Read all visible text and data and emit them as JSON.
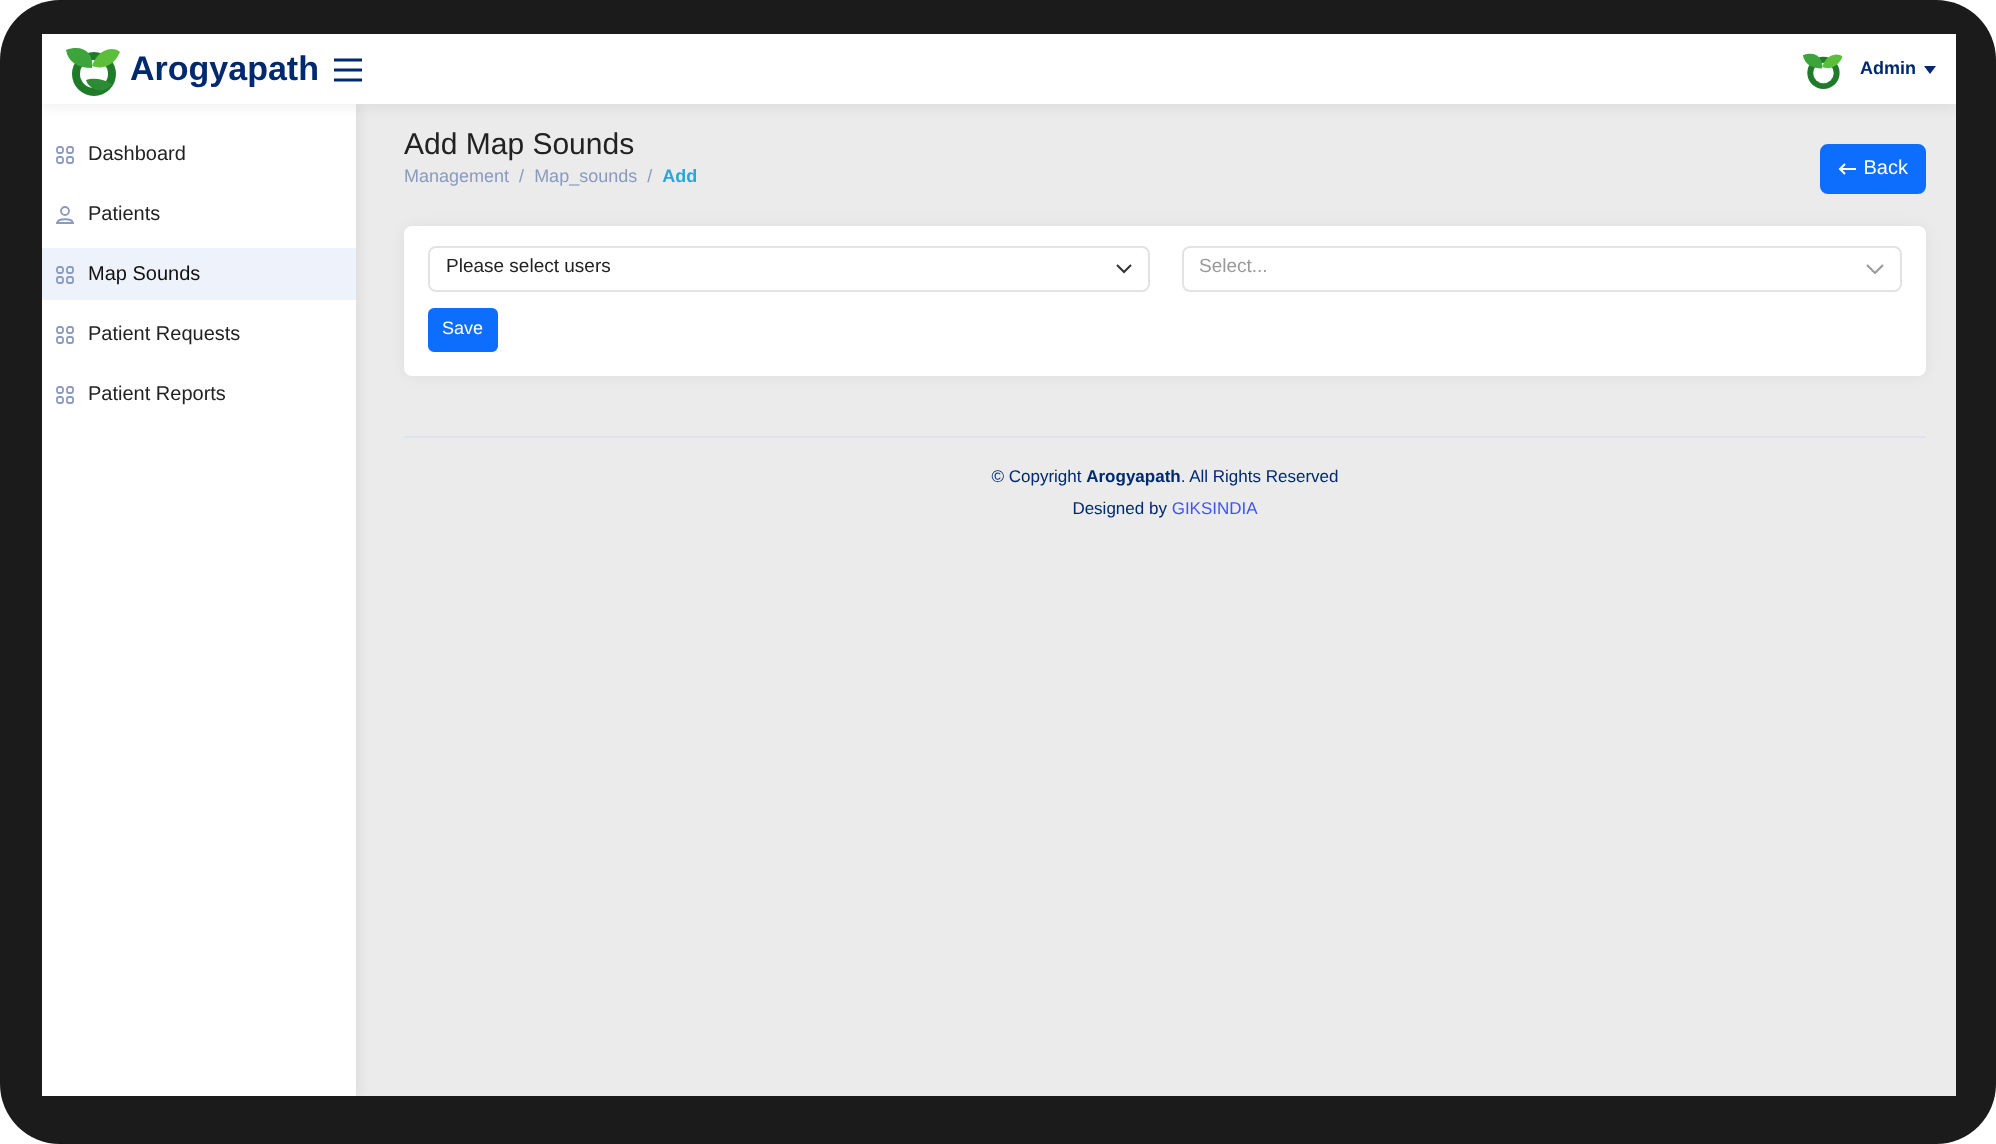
{
  "header": {
    "brand": "Arogyapath",
    "user": "Admin"
  },
  "sidebar": {
    "items": [
      {
        "label": "Dashboard",
        "kind": "grid",
        "selected": false
      },
      {
        "label": "Patients",
        "kind": "person",
        "selected": false
      },
      {
        "label": "Map Sounds",
        "kind": "grid",
        "selected": true
      },
      {
        "label": "Patient Requests",
        "kind": "grid",
        "selected": false
      },
      {
        "label": "Patient Reports",
        "kind": "grid",
        "selected": false
      }
    ]
  },
  "page": {
    "title": "Add Map Sounds",
    "breadcrumbs": [
      {
        "label": "Management",
        "active": false
      },
      {
        "label": "Map_sounds",
        "active": false
      },
      {
        "label": "Add",
        "active": true
      }
    ],
    "breadcrumb_separators": [
      "/",
      "/"
    ],
    "back_button": "Back"
  },
  "form": {
    "users_select": {
      "value": "Please select users"
    },
    "sounds_select": {
      "placeholder": "Select..."
    },
    "save_button": "Save"
  },
  "footer": {
    "copyright": "© Copyright **Arogyapath**. All Rights Reserved",
    "designed_by": "Designed by",
    "designer_link": "GIKSINDIA"
  }
}
